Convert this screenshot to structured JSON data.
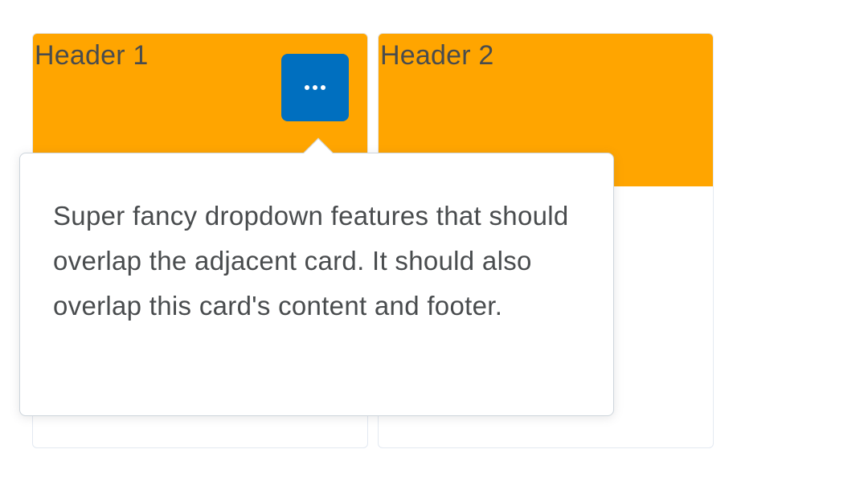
{
  "cards": [
    {
      "header": "Header 1"
    },
    {
      "header": "Header 2"
    }
  ],
  "more_button": {
    "icon": "more-horizontal-icon"
  },
  "dropdown": {
    "text": "Super fancy dropdown features that should overlap the adjacent card. It should also overlap this card's content and footer."
  },
  "colors": {
    "header_bg": "#ffa500",
    "button_bg": "#006fbf",
    "text": "#494c4e",
    "card_border": "#e3e9f1"
  }
}
